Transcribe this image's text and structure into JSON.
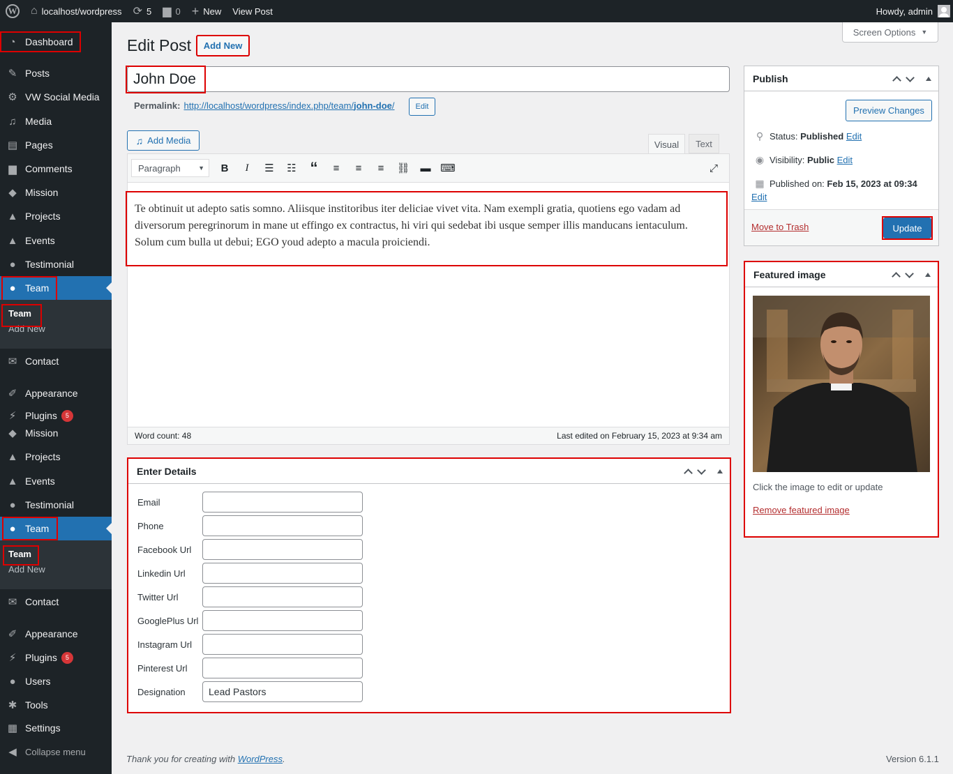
{
  "adminbar": {
    "site_name": "localhost/wordpress",
    "updates_count": "5",
    "comments_count": "0",
    "new_label": "New",
    "view_post_label": "View Post",
    "howdy": "Howdy, admin"
  },
  "sidebar": {
    "items": [
      {
        "label": "Dashboard",
        "icon": "dashboard-icon"
      },
      {
        "label": "Posts",
        "icon": "pin-icon"
      },
      {
        "label": "VW Social Media",
        "icon": "gear-icon"
      },
      {
        "label": "Media",
        "icon": "media-icon"
      },
      {
        "label": "Pages",
        "icon": "pages-icon"
      },
      {
        "label": "Comments",
        "icon": "comment-icon"
      },
      {
        "label": "Mission",
        "icon": "tag-icon"
      },
      {
        "label": "Projects",
        "icon": "cap-icon"
      },
      {
        "label": "Events",
        "icon": "cap-icon"
      },
      {
        "label": "Testimonial",
        "icon": "person-icon"
      },
      {
        "label": "Team",
        "icon": "person-icon"
      },
      {
        "label": "Contact",
        "icon": "envelope-icon"
      },
      {
        "label": "Appearance",
        "icon": "brush-icon"
      },
      {
        "label": "Plugins",
        "icon": "plug-icon"
      },
      {
        "label": "Mission",
        "icon": "tag-icon"
      },
      {
        "label": "Projects",
        "icon": "cap-icon"
      },
      {
        "label": "Events",
        "icon": "cap-icon"
      },
      {
        "label": "Testimonial",
        "icon": "person-icon"
      },
      {
        "label": "Team",
        "icon": "person-icon"
      },
      {
        "label": "Contact",
        "icon": "envelope-icon"
      },
      {
        "label": "Appearance",
        "icon": "brush-icon"
      },
      {
        "label": "Plugins",
        "icon": "plug-icon"
      },
      {
        "label": "Users",
        "icon": "users-icon"
      },
      {
        "label": "Tools",
        "icon": "wrench-icon"
      },
      {
        "label": "Settings",
        "icon": "settings-icon"
      },
      {
        "label": "Collapse menu",
        "icon": "collapse-icon"
      }
    ],
    "submenu": {
      "current": "Team",
      "add_new": "Add New"
    },
    "plugins_badge": "5"
  },
  "header": {
    "title": "Edit Post",
    "add_new": "Add New",
    "screen_options": "Screen Options"
  },
  "post": {
    "title": "John Doe",
    "permalink_label": "Permalink:",
    "permalink_base": "http://localhost/wordpress/index.php/team/",
    "permalink_slug": "john-doe",
    "permalink_end": "/",
    "permalink_edit": "Edit"
  },
  "editor": {
    "add_media": "Add Media",
    "tab_visual": "Visual",
    "tab_text": "Text",
    "format_select": "Paragraph",
    "content": "Te obtinuit ut adepto satis somno. Aliisque institoribus iter deliciae vivet vita. Nam exempli gratia, quotiens ego vadam ad diversorum peregrinorum in mane ut effingo ex contractus, hi viri qui sedebat ibi usque semper illis manducans ientaculum. Solum cum bulla ut debui; EGO youd adepto a macula proiciendi.",
    "word_count": "Word count: 48",
    "last_edited": "Last edited on February 15, 2023 at 9:34 am"
  },
  "details": {
    "title": "Enter Details",
    "fields": [
      {
        "label": "Email",
        "value": ""
      },
      {
        "label": "Phone",
        "value": ""
      },
      {
        "label": "Facebook Url",
        "value": ""
      },
      {
        "label": "Linkedin Url",
        "value": ""
      },
      {
        "label": "Twitter Url",
        "value": ""
      },
      {
        "label": "GooglePlus Url",
        "value": ""
      },
      {
        "label": "Instagram Url",
        "value": ""
      },
      {
        "label": "Pinterest Url",
        "value": ""
      },
      {
        "label": "Designation",
        "value": "Lead Pastors"
      }
    ]
  },
  "publish": {
    "title": "Publish",
    "preview": "Preview Changes",
    "status_label": "Status:",
    "status_value": "Published",
    "visibility_label": "Visibility:",
    "visibility_value": "Public",
    "published_label": "Published on:",
    "published_value": "Feb 15, 2023 at 09:34",
    "edit": "Edit",
    "trash": "Move to Trash",
    "update": "Update"
  },
  "featured": {
    "title": "Featured image",
    "hint": "Click the image to edit or update",
    "remove": "Remove featured image"
  },
  "footer": {
    "thanks": "Thank you for creating with",
    "wp": "WordPress",
    "dot": ".",
    "version": "Version 6.1.1"
  },
  "colors": {
    "accent": "#2271b1",
    "sidebar": "#1d2327",
    "highlight": "#dd0000"
  }
}
